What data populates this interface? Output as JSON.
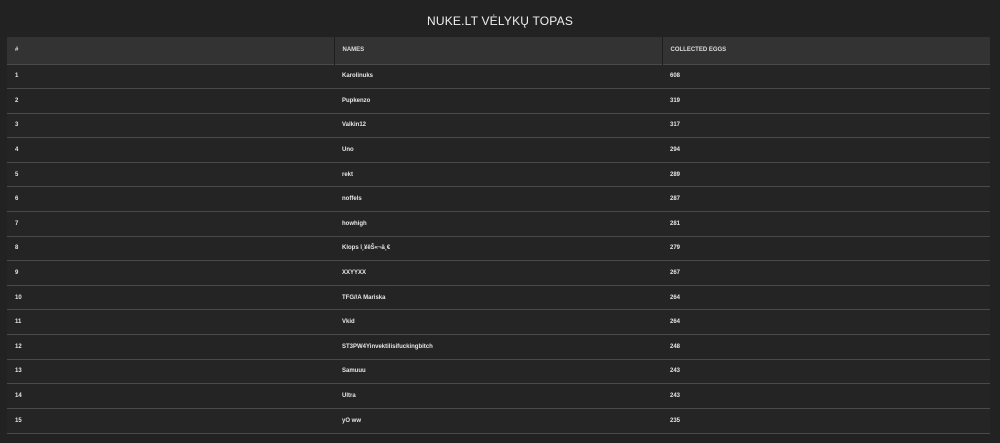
{
  "page": {
    "title": "NUKE.LT VĖLYKŲ TOPAS"
  },
  "table": {
    "headers": {
      "rank": "#",
      "names": "NAMES",
      "eggs": "COLLECTED EGGS"
    },
    "rows": [
      {
        "rank": "1",
        "name": "Karolinuks",
        "eggs": "608"
      },
      {
        "rank": "2",
        "name": "Pupkenzo",
        "eggs": "319"
      },
      {
        "rank": "3",
        "name": "Valkin12",
        "eggs": "317"
      },
      {
        "rank": "4",
        "name": "Uno",
        "eggs": "294"
      },
      {
        "rank": "5",
        "name": "rekt",
        "eggs": "289"
      },
      {
        "rank": "6",
        "name": "noffels",
        "eggs": "287"
      },
      {
        "rank": "7",
        "name": "howhigh",
        "eggs": "281"
      },
      {
        "rank": "8",
        "name": "Klops î¸¥êŠ«¬ä¸€",
        "eggs": "279"
      },
      {
        "rank": "9",
        "name": "XXYYXX",
        "eggs": "267"
      },
      {
        "rank": "10",
        "name": "TFG//A Mariska",
        "eggs": "264"
      },
      {
        "rank": "11",
        "name": "Vkid",
        "eggs": "264"
      },
      {
        "rank": "12",
        "name": "ST3PW4Yinvektilisifuckingbitch",
        "eggs": "248"
      },
      {
        "rank": "13",
        "name": "Samuuu",
        "eggs": "243"
      },
      {
        "rank": "14",
        "name": "Ultra",
        "eggs": "243"
      },
      {
        "rank": "15",
        "name": "yO ww",
        "eggs": "235"
      }
    ]
  },
  "colors": {
    "background": "#222222",
    "header_background": "#333333",
    "row_divider": "#4a4a4a",
    "text": "#e6e6e6"
  }
}
